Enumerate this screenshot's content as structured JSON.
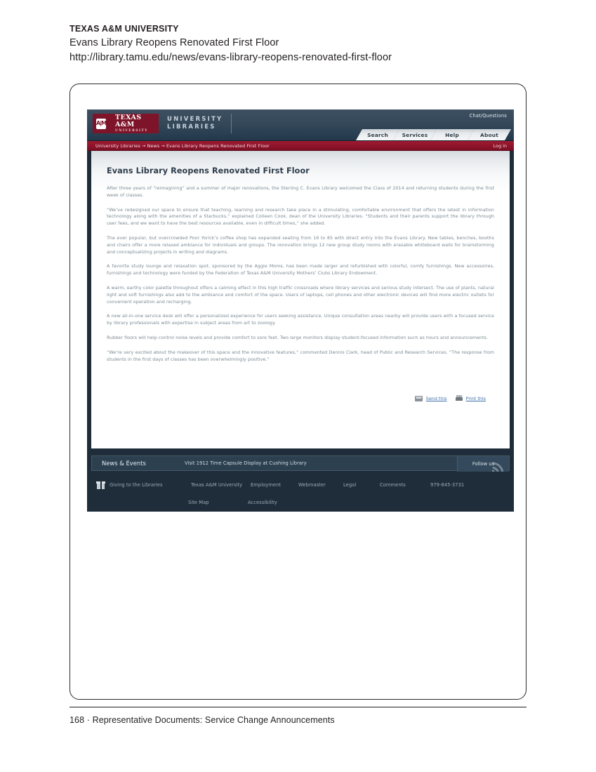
{
  "document": {
    "kicker": "TEXAS A&M UNIVERSITY",
    "title": "Evans Library Reopens Renovated First Floor",
    "url": "http://library.tamu.edu/news/evans-library-reopens-renovated-first-floor",
    "footer_page": "168",
    "footer_sep": "·",
    "footer_text": "Representative Documents:  Service Change Announcements"
  },
  "site": {
    "brand": {
      "seal": "A|M",
      "line1": "TEXAS A&M",
      "line2": "UNIVERSITY",
      "unit_line1": "UNIVERSITY",
      "unit_line2": "LIBRARIES"
    },
    "chat_link": "Chat/Questions",
    "tabs": [
      {
        "label": "Search"
      },
      {
        "label": "Services"
      },
      {
        "label": "Help"
      },
      {
        "label": "About"
      }
    ],
    "breadcrumb": "University Libraries → News → Evans Library Reopens Renovated First Floor",
    "login": "Log in",
    "content": {
      "heading": "Evans Library Reopens Renovated First Floor",
      "paragraphs": [
        "After three years of “reimagining” and a summer of major renovations, the Sterling C. Evans Library welcomed the Class of 2014 and returning students during the first week of classes.",
        "“We’ve redesigned our space to ensure that teaching, learning and research take place in a stimulating, comfortable environment that offers the latest in information technology along with the amenities of a Starbucks,” explained Colleen Cook, dean of the University Libraries. “Students and their parents support the library through user fees, and we want to have the best resources available, even in difficult times,” she added.",
        "The ever popular, but overcrowded Poor Yorick’s coffee shop has expanded seating from 16 to 85 with direct entry into the Evans Library. New tables, benches, booths and chairs offer a more relaxed ambiance for individuals and groups. The renovation brings 12 new group study rooms with erasable whiteboard walls for brainstorming and conceptualizing projects in writing and diagrams.",
        "A favorite study lounge and relaxation spot, sponsored by the Aggie Moms, has been made larger and refurbished with colorful, comfy furnishings. New accessories, furnishings and technology were funded by the Federation of Texas A&M University Mothers’ Clubs Library Endowment.",
        "A warm, earthy color palette throughout offers a calming effect in this high traffic crossroads where library services and serious study intersect. The use of plants, natural light and soft furnishings also add to the ambiance and comfort of the space. Users of laptops, cell phones and other electronic devices will find more electric outlets for convenient operation and recharging.",
        "A new all-in-one service desk will offer a personalized experience for users seeking assistance. Unique consultation areas nearby will provide users with a focused service by library professionals with expertise in subject areas from art to zoology.",
        "Rubber floors will help control noise levels and provide comfort to sore feet. Two large monitors display student-focused information such as hours and announcements.",
        "“We’re very excited about the makeover of this space and the innovative features,” commented Dennis Clark, head of Public and Research Services. “The response from students in the first days of classes has been overwhelmingly positive.”"
      ]
    },
    "actions": {
      "send": "Send this",
      "print": "Print this"
    },
    "news_bar": {
      "title": "News & Events",
      "item": "Visit 1912 Time Capsule Display at Cushing Library",
      "follow": "Follow us"
    },
    "footer": {
      "giving": "Giving to the Libraries",
      "row1": [
        {
          "label": "Texas A&M University"
        },
        {
          "label": "Employment"
        },
        {
          "label": "Webmaster"
        },
        {
          "label": "Legal"
        },
        {
          "label": "Comments"
        },
        {
          "label": "979-845-3731"
        }
      ],
      "row2": [
        {
          "label": "Site Map"
        },
        {
          "label": "Accessibility"
        }
      ]
    }
  },
  "colors": {
    "maroon": "#7e1429",
    "crumb_maroon": "#8c1229",
    "navy": "#1e2d39",
    "header_navy": "#34485a",
    "link_blue": "#3f6fa8",
    "body_gray": "#7b8a93"
  }
}
